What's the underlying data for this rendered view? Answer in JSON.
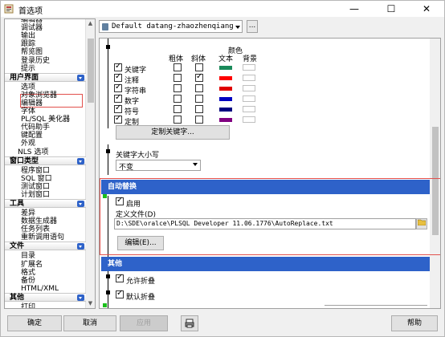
{
  "window": {
    "title": "首选项",
    "controls": {
      "minimize": "—",
      "maximize": "☐",
      "close": "✕"
    }
  },
  "tree": {
    "items": [
      {
        "type": "item",
        "label": "编辑器"
      },
      {
        "type": "item",
        "label": "调试器"
      },
      {
        "type": "item",
        "label": "输出"
      },
      {
        "type": "item",
        "label": "跟踪"
      },
      {
        "type": "item",
        "label": "帮览图"
      },
      {
        "type": "item",
        "label": "登录历史"
      },
      {
        "type": "item",
        "label": "提示"
      },
      {
        "type": "group",
        "label": "用户界面"
      },
      {
        "type": "item",
        "label": "选项"
      },
      {
        "type": "item",
        "label": "对象浏览器"
      },
      {
        "type": "item",
        "label": "编辑器"
      },
      {
        "type": "item",
        "label": "字体"
      },
      {
        "type": "item",
        "label": "PL/SQL 美化器"
      },
      {
        "type": "item",
        "label": "代码助手"
      },
      {
        "type": "item",
        "label": "键配置"
      },
      {
        "type": "item",
        "label": "外观"
      },
      {
        "type": "item2",
        "label": "NLS 选项"
      },
      {
        "type": "group",
        "label": "窗口类型"
      },
      {
        "type": "item",
        "label": "程序窗口"
      },
      {
        "type": "item",
        "label": "SQL 窗口"
      },
      {
        "type": "item",
        "label": "测试窗口"
      },
      {
        "type": "item",
        "label": "计划窗口"
      },
      {
        "type": "group",
        "label": "工具"
      },
      {
        "type": "item",
        "label": "差异"
      },
      {
        "type": "item",
        "label": "数据生成器"
      },
      {
        "type": "item",
        "label": "任务列表"
      },
      {
        "type": "item",
        "label": "重新调用语句"
      },
      {
        "type": "group",
        "label": "文件"
      },
      {
        "type": "item",
        "label": "目录"
      },
      {
        "type": "item",
        "label": "扩展名"
      },
      {
        "type": "item",
        "label": "格式"
      },
      {
        "type": "item",
        "label": "备份"
      },
      {
        "type": "item",
        "label": "HTML/XML"
      },
      {
        "type": "group",
        "label": "其他"
      },
      {
        "type": "item",
        "label": "打印"
      },
      {
        "type": "item",
        "label": "更新与消息"
      }
    ]
  },
  "profile": {
    "value": "Default datang-zhaozhenqiang",
    "more": "..."
  },
  "syntax": {
    "headers": {
      "bold": "粗体",
      "italic": "斜体",
      "color": "颜色",
      "text": "文本",
      "background": "背景"
    },
    "rows": [
      {
        "label": "关键字",
        "bold": false,
        "italic": false,
        "color": "#1a8a5a"
      },
      {
        "label": "注释",
        "bold": false,
        "italic": true,
        "color": "#ff0000"
      },
      {
        "label": "字符串",
        "bold": false,
        "italic": false,
        "color": "#e00000"
      },
      {
        "label": "数字",
        "bold": false,
        "italic": false,
        "color": "#0000c0"
      },
      {
        "label": "符号",
        "bold": false,
        "italic": false,
        "color": "#000080"
      },
      {
        "label": "定制",
        "bold": false,
        "italic": false,
        "color": "#800080"
      }
    ],
    "custom_keywords_button": "定制关键字..."
  },
  "keyword_case": {
    "label": "关键字大小写",
    "value": "不变"
  },
  "autoreplace": {
    "section_title": "自动替换",
    "enabled_label": "启用",
    "file_label": "定义文件(D)",
    "file_value": "D:\\SDE\\oralce\\PLSQL Developer 11.06.1776\\AutoReplace.txt",
    "edit_button": "编辑(E)..."
  },
  "other": {
    "section_title": "其他",
    "allow_fold": "允许折叠",
    "default_fold": "默认折叠"
  },
  "buttons": {
    "ok": "确定",
    "cancel": "取消",
    "apply": "应用",
    "help": "帮助"
  },
  "colors": {
    "accent": "#2e62c9",
    "highlight": "#e2504c"
  }
}
